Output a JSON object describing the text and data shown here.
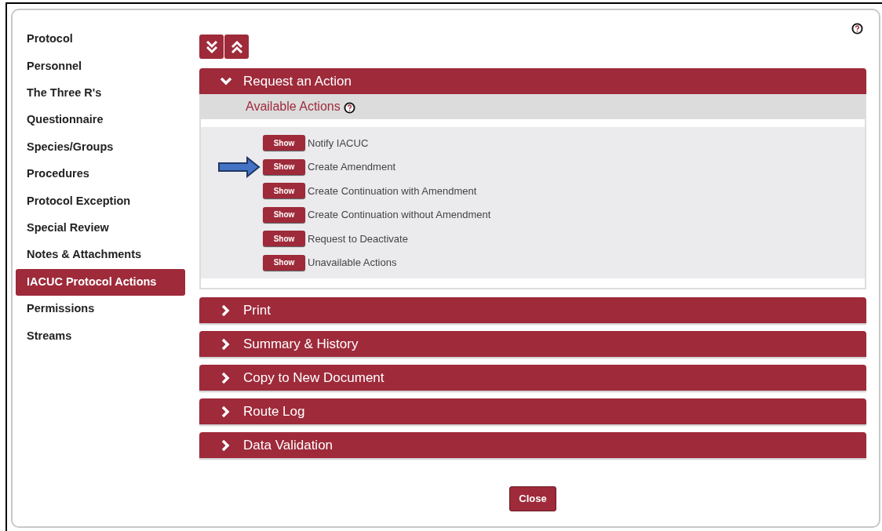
{
  "sidebar": {
    "items": [
      {
        "label": "Protocol",
        "selected": false
      },
      {
        "label": "Personnel",
        "selected": false
      },
      {
        "label": "The Three R's",
        "selected": false
      },
      {
        "label": "Questionnaire",
        "selected": false
      },
      {
        "label": "Species/Groups",
        "selected": false
      },
      {
        "label": "Procedures",
        "selected": false
      },
      {
        "label": "Protocol Exception",
        "selected": false
      },
      {
        "label": "Special Review",
        "selected": false
      },
      {
        "label": "Notes & Attachments",
        "selected": false
      },
      {
        "label": "IACUC Protocol Actions",
        "selected": true
      },
      {
        "label": "Permissions",
        "selected": false
      },
      {
        "label": "Streams",
        "selected": false
      }
    ]
  },
  "sections": [
    {
      "title": "Request an Action",
      "expanded": true,
      "subheading": "Available Actions",
      "actions": [
        {
          "button": "Show",
          "label": "Notify IACUC",
          "pointed": false
        },
        {
          "button": "Show",
          "label": "Create Amendment",
          "pointed": true
        },
        {
          "button": "Show",
          "label": "Create Continuation with Amendment",
          "pointed": false
        },
        {
          "button": "Show",
          "label": "Create Continuation without Amendment",
          "pointed": false
        },
        {
          "button": "Show",
          "label": "Request to Deactivate",
          "pointed": false
        },
        {
          "button": "Show",
          "label": "Unavailable Actions",
          "pointed": false
        }
      ]
    },
    {
      "title": "Print",
      "expanded": false
    },
    {
      "title": "Summary & History",
      "expanded": false
    },
    {
      "title": "Copy to New Document",
      "expanded": false
    },
    {
      "title": "Route Log",
      "expanded": false
    },
    {
      "title": "Data Validation",
      "expanded": false
    }
  ],
  "close_button": "Close"
}
